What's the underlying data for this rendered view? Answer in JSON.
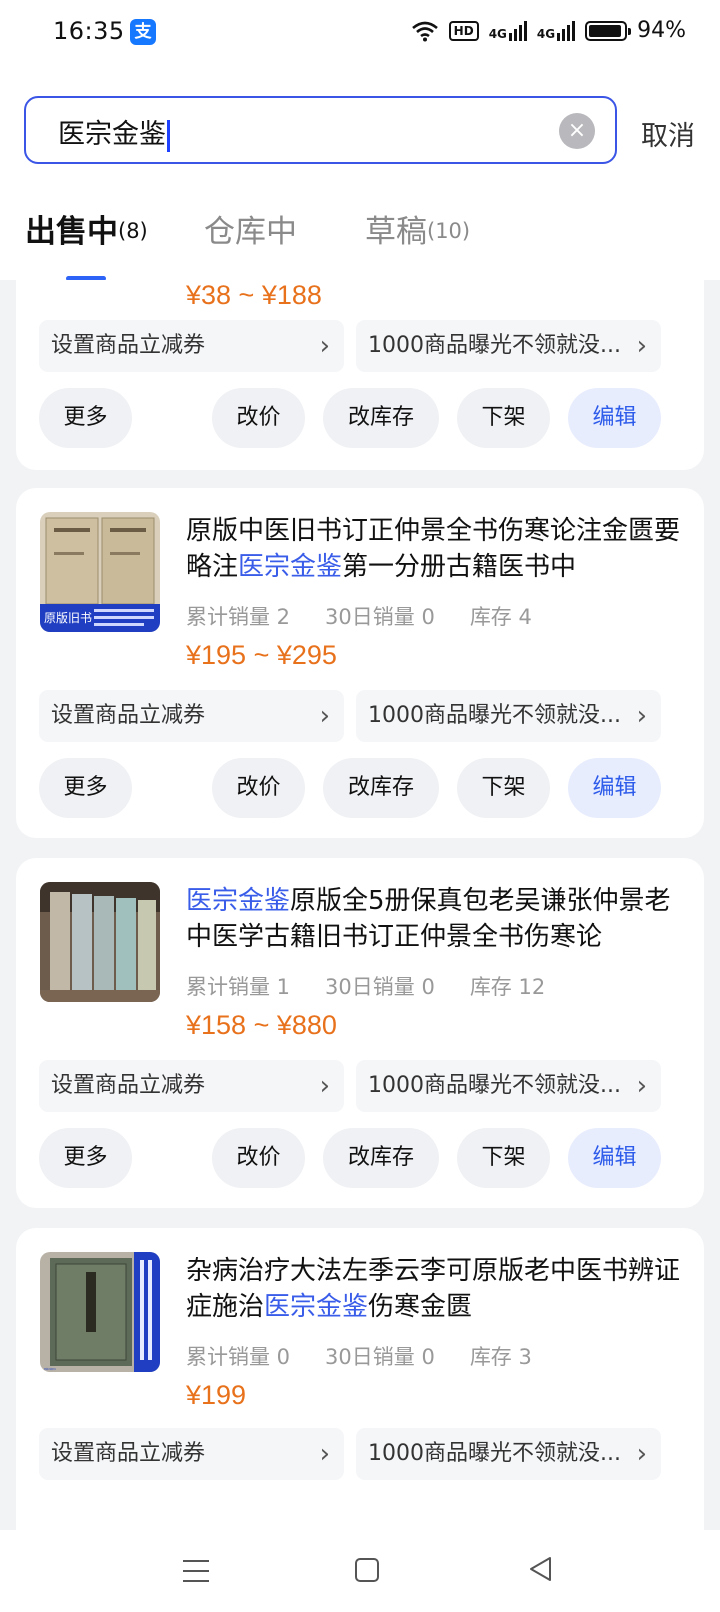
{
  "status_bar": {
    "time": "16:35",
    "app_badge": "支",
    "network_badge": "HD",
    "signal1": "4G",
    "signal2": "4G",
    "battery": "94%",
    "battery_level": 0.94
  },
  "search": {
    "value": "医宗金鉴",
    "clear_icon": "×",
    "cancel_label": "取消"
  },
  "tabs": [
    {
      "label": "出售中",
      "count": "(8)",
      "active": true
    },
    {
      "label": "仓库中",
      "count": "",
      "active": false
    },
    {
      "label": "草稿",
      "count": "(10)",
      "active": false
    }
  ],
  "products": [
    {
      "title_parts": [
        "",
        "",
        ""
      ],
      "stats": {
        "sales_total": "",
        "sales_30d": "",
        "stock": ""
      },
      "price": "¥38 ~ ¥188",
      "promo_left": "设置商品立减券",
      "promo_right": "1000商品曝光不领就没...",
      "buttons": {
        "more": "更多",
        "price": "改价",
        "stock": "改库存",
        "delist": "下架",
        "edit": "编辑"
      }
    },
    {
      "title_parts": [
        "原版中医旧书订正仲景全书伤寒论注金匮要略注",
        "医宗金鉴",
        "第一分册古籍医书中"
      ],
      "stats": {
        "sales_total": "累计销量 2",
        "sales_30d": "30日销量 0",
        "stock": "库存 4"
      },
      "price": "¥195 ~ ¥295",
      "thumb_label": "原版旧书",
      "promo_left": "设置商品立减券",
      "promo_right": "1000商品曝光不领就没...",
      "buttons": {
        "more": "更多",
        "price": "改价",
        "stock": "改库存",
        "delist": "下架",
        "edit": "编辑"
      }
    },
    {
      "title_parts": [
        "",
        "医宗金鉴",
        "原版全5册保真包老吴谦张仲景老中医学古籍旧书订正仲景全书伤寒论"
      ],
      "stats": {
        "sales_total": "累计销量 1",
        "sales_30d": "30日销量 0",
        "stock": "库存 12"
      },
      "price": "¥158 ~ ¥880",
      "promo_left": "设置商品立减券",
      "promo_right": "1000商品曝光不领就没...",
      "buttons": {
        "more": "更多",
        "price": "改价",
        "stock": "改库存",
        "delist": "下架",
        "edit": "编辑"
      }
    },
    {
      "title_parts": [
        "杂病治疗大法左季云李可原版老中医书辨证症施治",
        "医宗金鉴",
        "伤寒金匮"
      ],
      "stats": {
        "sales_total": "累计销量 0",
        "sales_30d": "30日销量 0",
        "stock": "库存 3"
      },
      "price": "¥199",
      "thumb_label": "原版正版旧书",
      "promo_left": "设置商品立减券",
      "promo_right": "1000商品曝光不领就没..."
    }
  ]
}
